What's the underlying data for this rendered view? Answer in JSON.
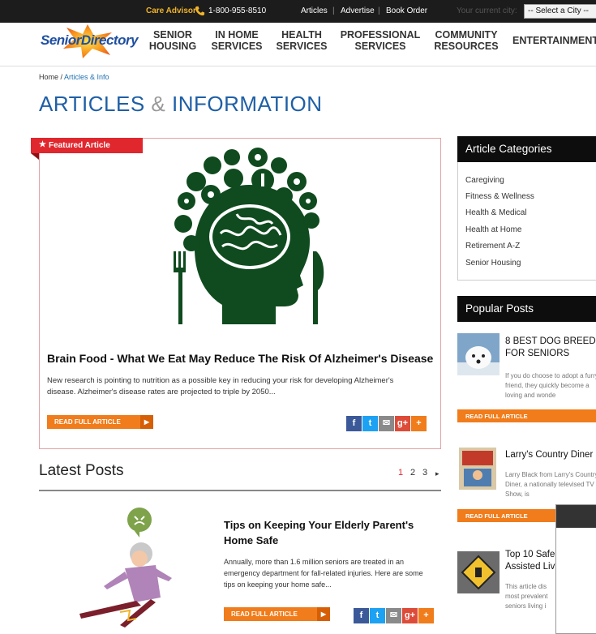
{
  "topbar": {
    "care_advisor": "Care Advisor",
    "phone": "1-800-955-8510",
    "links": [
      "Articles",
      "Advertise",
      "Book Order"
    ],
    "city_label": "Your current city:",
    "city_select": "-- Select a City --"
  },
  "header": {
    "logo": "SeniorDirectory",
    "nav": [
      {
        "line1": "SENIOR",
        "line2": "HOUSING"
      },
      {
        "line1": "IN HOME",
        "line2": "SERVICES"
      },
      {
        "line1": "HEALTH",
        "line2": "SERVICES"
      },
      {
        "line1": "PROFESSIONAL",
        "line2": "SERVICES"
      },
      {
        "line1": "COMMUNITY",
        "line2": "RESOURCES"
      },
      {
        "line1": "ENTERTAINMENT",
        "line2": ""
      }
    ]
  },
  "breadcrumb": {
    "home": "Home",
    "sep": " / ",
    "current": "Articles & Info"
  },
  "title": {
    "part1": "ARTICLES",
    "amp": " & ",
    "part2": "INFORMATION"
  },
  "featured": {
    "tag": "Featured Article",
    "headline": "Brain Food - What We Eat May Reduce The Risk Of Alzheimer's Disease",
    "excerpt": "New research is pointing to nutrition as a possible key in reducing your risk for developing Alzheimer's disease.  Alzheimer's disease rates are projected to triple by 2050...",
    "read_more": "READ FULL ARTICLE"
  },
  "latest": {
    "title": "Latest Posts",
    "pages": [
      "1",
      "2",
      "3"
    ],
    "next": "▸",
    "post": {
      "title": "Tips on Keeping Your Elderly Parent's Home Safe",
      "excerpt": "Annually, more than 1.6 million seniors are treated in an emergency department for fall-related injuries.  Here are some tips on keeping your home safe...",
      "read_more": "READ FULL ARTICLE"
    }
  },
  "sidebar": {
    "categories_title": "Article Categories",
    "categories": [
      "Caregiving",
      "Fitness & Wellness",
      "Health & Medical",
      "Health at Home",
      "Retirement A-Z",
      "Senior Housing"
    ],
    "popular_title": "Popular Posts",
    "popular": [
      {
        "title": "8 BEST DOG BREEDS FOR SENIORS",
        "excerpt": "If you do choose to adopt a furry friend, they quickly become a loving and wonde",
        "read_more": "READ FULL ARTICLE"
      },
      {
        "title": "Larry's Country Diner",
        "excerpt": "Larry Black from Larry's Country Diner, a nationally televised TV Show, is",
        "read_more": "READ FULL ARTICLE"
      },
      {
        "title": "Top 10 Safe Assisted Liv",
        "excerpt": "This article dis most prevalent seniors living i"
      }
    ]
  },
  "colors": {
    "accent_blue": "#1e5fa6",
    "accent_red": "#e0272e",
    "accent_orange": "#f07c1b",
    "brain_green": "#0f4b1e"
  }
}
